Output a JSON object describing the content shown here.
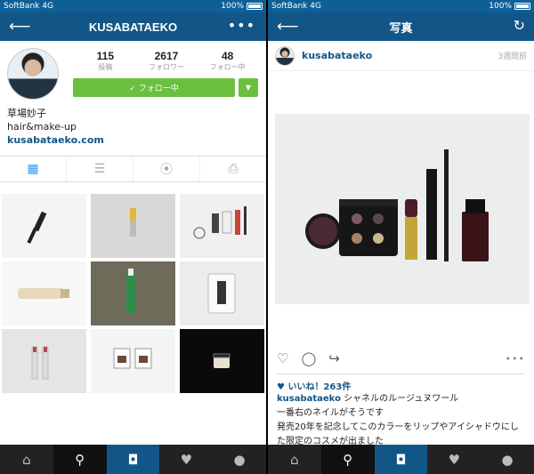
{
  "status_bar": {
    "carrier": "SoftBank",
    "network": "4G",
    "time": "",
    "battery": "100%"
  },
  "left": {
    "title": "KUSABATAEKO",
    "back_icon": "arrow-left-icon",
    "more_icon": "more-icon",
    "stats": [
      {
        "value": "115",
        "label": "投稿"
      },
      {
        "value": "2617",
        "label": "フォロワー"
      },
      {
        "value": "48",
        "label": "フォロー中"
      }
    ],
    "follow_label": "✓ フォロー中",
    "bio": {
      "name": "草場妙子",
      "description": "hair&make-up",
      "link": "kusabataeko.com"
    },
    "tabs": [
      "grid-icon",
      "list-icon",
      "location-icon",
      "tagged-icon"
    ],
    "grid_icons": [
      "mascara",
      "lipstick",
      "makeup-tools",
      "tube",
      "serum",
      "bag",
      "lipsticks",
      "palette",
      "cream-jar"
    ]
  },
  "right": {
    "title": "写真",
    "username": "kusabataeko",
    "time_ago": "3週間前",
    "likes": "いいね！263件",
    "caption_user": "kusabataeko",
    "caption_text": "シャネルのルージュヌワール",
    "caption_line2": "一番右のネイルがそうです",
    "caption_line3": "発売20年を記念してこのカラーをリップやアイシャドウにした限定のコスメが出ました"
  },
  "tabbar": [
    "home-icon",
    "search-icon",
    "camera-icon",
    "activity-icon",
    "profile-icon"
  ],
  "colors": {
    "nav": "#125688",
    "follow": "#6bbf3f",
    "link": "#125688"
  }
}
